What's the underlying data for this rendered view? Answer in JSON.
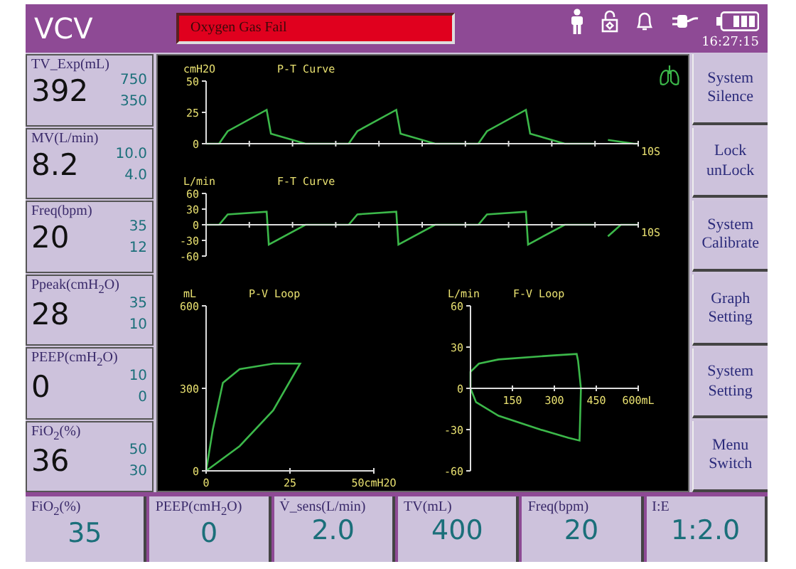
{
  "header": {
    "mode": "VCV",
    "alarm": "Oxygen Gas Fail",
    "time": "16:27:15"
  },
  "monitors": [
    {
      "label": "TV_Exp(mL)",
      "value": "392",
      "upper": "750",
      "lower": "350"
    },
    {
      "label": "MV(L/min)",
      "value": "8.2",
      "upper": "10.0",
      "lower": "4.0"
    },
    {
      "label": "Freq(bpm)",
      "value": "20",
      "upper": "35",
      "lower": "12"
    },
    {
      "label": "Ppeak(cmH$_{2}$O)",
      "value": "28",
      "upper": "35",
      "lower": "10"
    },
    {
      "label": "PEEP(cmH$_{2}$O)",
      "value": "0",
      "upper": "10",
      "lower": "0"
    },
    {
      "label": "FiO$_{2}$(%)",
      "value": "36",
      "upper": "50",
      "lower": "30"
    }
  ],
  "graphs": [
    {
      "kind": "pressure_wave",
      "unit": "cmH2O",
      "title": "P-T  Curve",
      "y_labels": [
        "50",
        "25",
        "0"
      ],
      "end_label": "10S"
    },
    {
      "kind": "flow_wave",
      "unit": "L/min",
      "title": "F-T  Curve",
      "y_labels": [
        "60",
        "30",
        "0",
        "-30",
        "-60"
      ],
      "end_label": "10S"
    },
    {
      "kind": "pv_loop",
      "unit": "mL",
      "title": "P-V  Loop",
      "y_labels": [
        "600",
        "300",
        "0"
      ],
      "x_labels": [
        "0",
        "25",
        "50cmH2O"
      ]
    },
    {
      "kind": "fv_loop",
      "unit": "L/min",
      "title": "F-V  Loop",
      "y_labels": [
        "60",
        "30",
        "0",
        "-30",
        "-60"
      ],
      "x_labels": [
        "150",
        "300",
        "450",
        "600mL"
      ]
    }
  ],
  "buttons": [
    "System Silence",
    "Lock unLock",
    "System Calibrate",
    "Graph Setting",
    "System Setting",
    "Menu Switch"
  ],
  "settings": [
    {
      "label": "FiO$_{2}$(%)",
      "value": "35"
    },
    {
      "label": "PEEP(cmH$_{2}$O)",
      "value": "0"
    },
    {
      "label": "V̇_sens(L/min)",
      "value": "2.0"
    },
    {
      "label": "TV(mL)",
      "value": "400"
    },
    {
      "label": "Freq(bpm)",
      "value": "20"
    },
    {
      "label": "I:E",
      "value": "1:2.0"
    }
  ]
}
